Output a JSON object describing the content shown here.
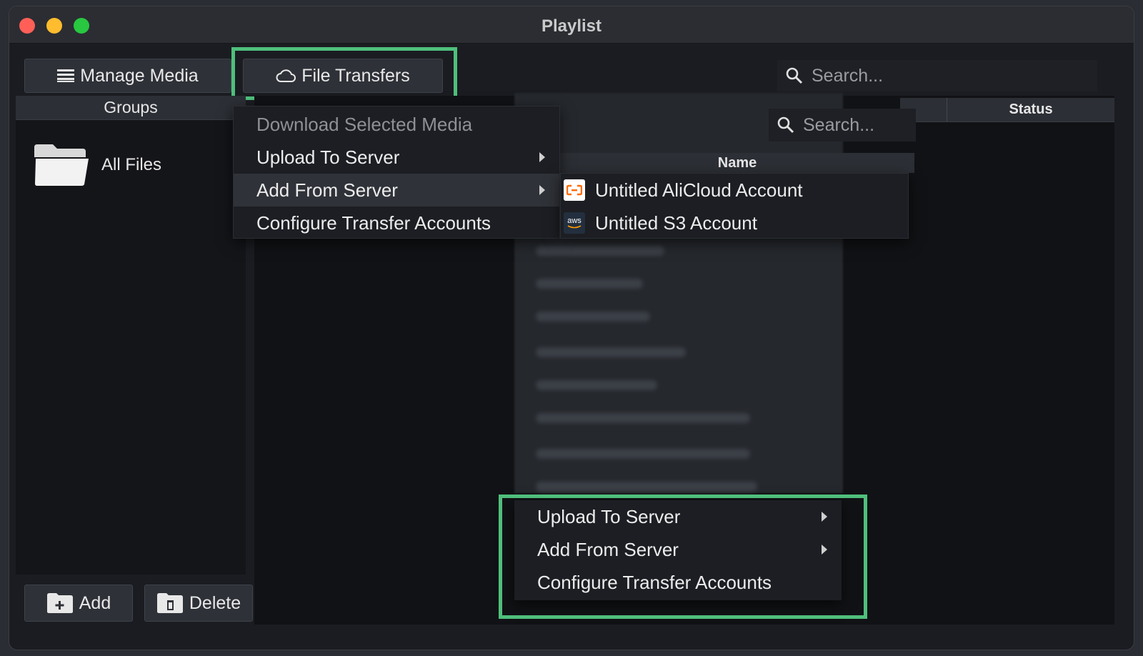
{
  "window": {
    "title": "Playlist"
  },
  "toolbar": {
    "manage_media_label": "Manage Media",
    "file_transfers_label": "File Transfers",
    "search_placeholder": "Search..."
  },
  "groups": {
    "header": "Groups",
    "items": [
      {
        "label": "All Files"
      }
    ],
    "add_label": "Add",
    "delete_label": "Delete"
  },
  "table": {
    "status_header": "Status",
    "name_header": "Name",
    "search_placeholder": "Search..."
  },
  "file_transfers_menu": {
    "items": [
      {
        "label": "Download Selected Media",
        "disabled": true,
        "submenu": false
      },
      {
        "label": "Upload To Server",
        "disabled": false,
        "submenu": true
      },
      {
        "label": "Add From Server",
        "disabled": false,
        "submenu": true,
        "hovered": true
      },
      {
        "label": "Configure Transfer Accounts",
        "disabled": false,
        "submenu": false
      }
    ]
  },
  "add_from_server_submenu": {
    "items": [
      {
        "label": "Untitled AliCloud Account",
        "icon": "alicloud-icon"
      },
      {
        "label": "Untitled S3 Account",
        "icon": "aws-icon",
        "icon_text": "aws"
      }
    ]
  },
  "context_menu": {
    "items": [
      {
        "label": "Upload To Server",
        "submenu": true
      },
      {
        "label": "Add From Server",
        "submenu": true
      },
      {
        "label": "Configure Transfer Accounts",
        "submenu": false
      }
    ]
  },
  "colors": {
    "highlight": "#4fbf7c",
    "alicloud": "#ff6a00"
  }
}
